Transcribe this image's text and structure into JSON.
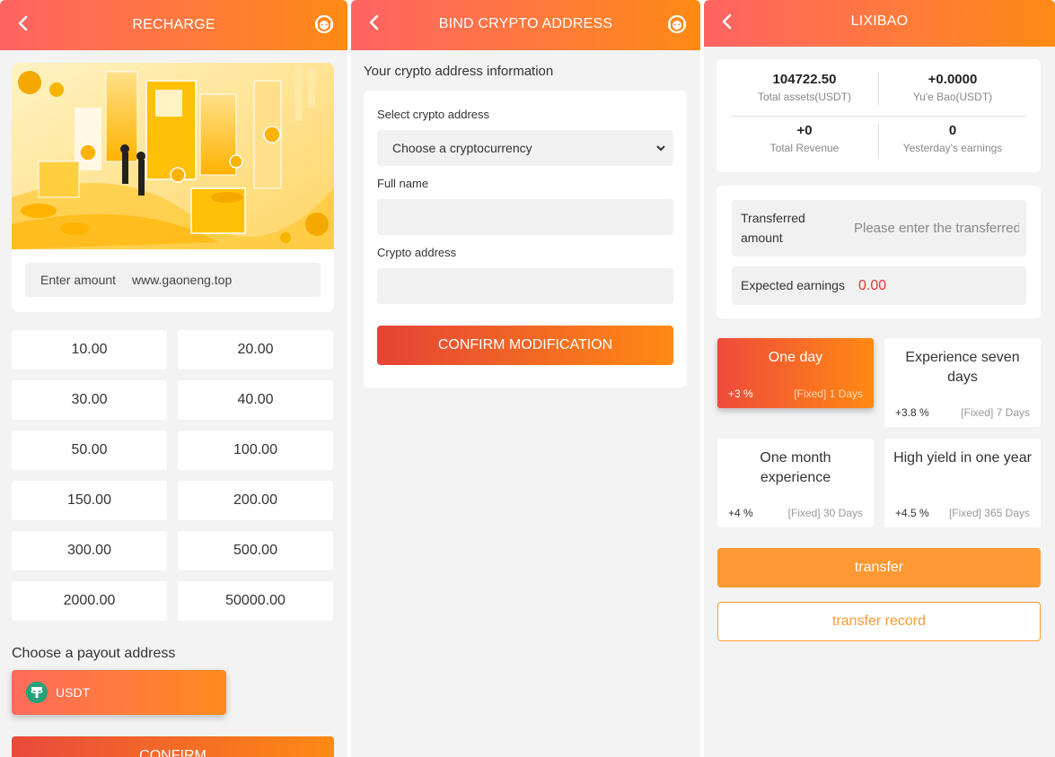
{
  "recharge": {
    "title": "RECHARGE",
    "amount_label": "Enter amount",
    "amount_placeholder": "www.gaoneng.top",
    "amounts": [
      "10.00",
      "20.00",
      "30.00",
      "40.00",
      "50.00",
      "100.00",
      "150.00",
      "200.00",
      "300.00",
      "500.00",
      "2000.00",
      "50000.00"
    ],
    "payout_title": "Choose a payout address",
    "payout_option": "USDT",
    "confirm_label": "CONFIRM"
  },
  "bind": {
    "title": "BIND CRYPTO ADDRESS",
    "section_title": "Your crypto address information",
    "select_label": "Select crypto address",
    "select_value": "Choose a cryptocurrency",
    "fullname_label": "Full name",
    "address_label": "Crypto address",
    "confirm_label": "CONFIRM MODIFICATION"
  },
  "lixibao": {
    "title": "LIXIBAO",
    "stats": [
      {
        "value": "104722.50",
        "label": "Total assets(USDT)"
      },
      {
        "value": "+0.0000",
        "label": "Yu'e Bao(USDT)"
      },
      {
        "value": "+0",
        "label": "Total Revenue"
      },
      {
        "value": "0",
        "label": "Yesterday's earnings"
      }
    ],
    "transfer_label": "Transferred amount",
    "transfer_placeholder": "Please enter the transferred amount",
    "earnings_label": "Expected earnings",
    "earnings_value": "0.00",
    "plans": [
      {
        "name": "One day",
        "rate": "+3 %",
        "term": "[Fixed] 1 Days",
        "selected": true
      },
      {
        "name": "Experience seven days",
        "rate": "+3.8 %",
        "term": "[Fixed] 7 Days",
        "selected": false
      },
      {
        "name": "One month experience",
        "rate": "+4 %",
        "term": "[Fixed] 30 Days",
        "selected": false
      },
      {
        "name": "High yield in one year",
        "rate": "+4.5 %",
        "term": "[Fixed] 365 Days",
        "selected": false
      }
    ],
    "transfer_button": "transfer",
    "record_button": "transfer record"
  },
  "colors": {
    "header_start": "#ff6363",
    "header_end": "#ff8a14",
    "accent_orange": "#ff9933",
    "earnings_red": "#e33333",
    "usdt_green": "#26a17b"
  },
  "icons": {
    "back": "chevron-left-icon",
    "service": "customer-service-icon",
    "select_caret": "chevron-down-icon",
    "usdt": "tether-icon"
  }
}
